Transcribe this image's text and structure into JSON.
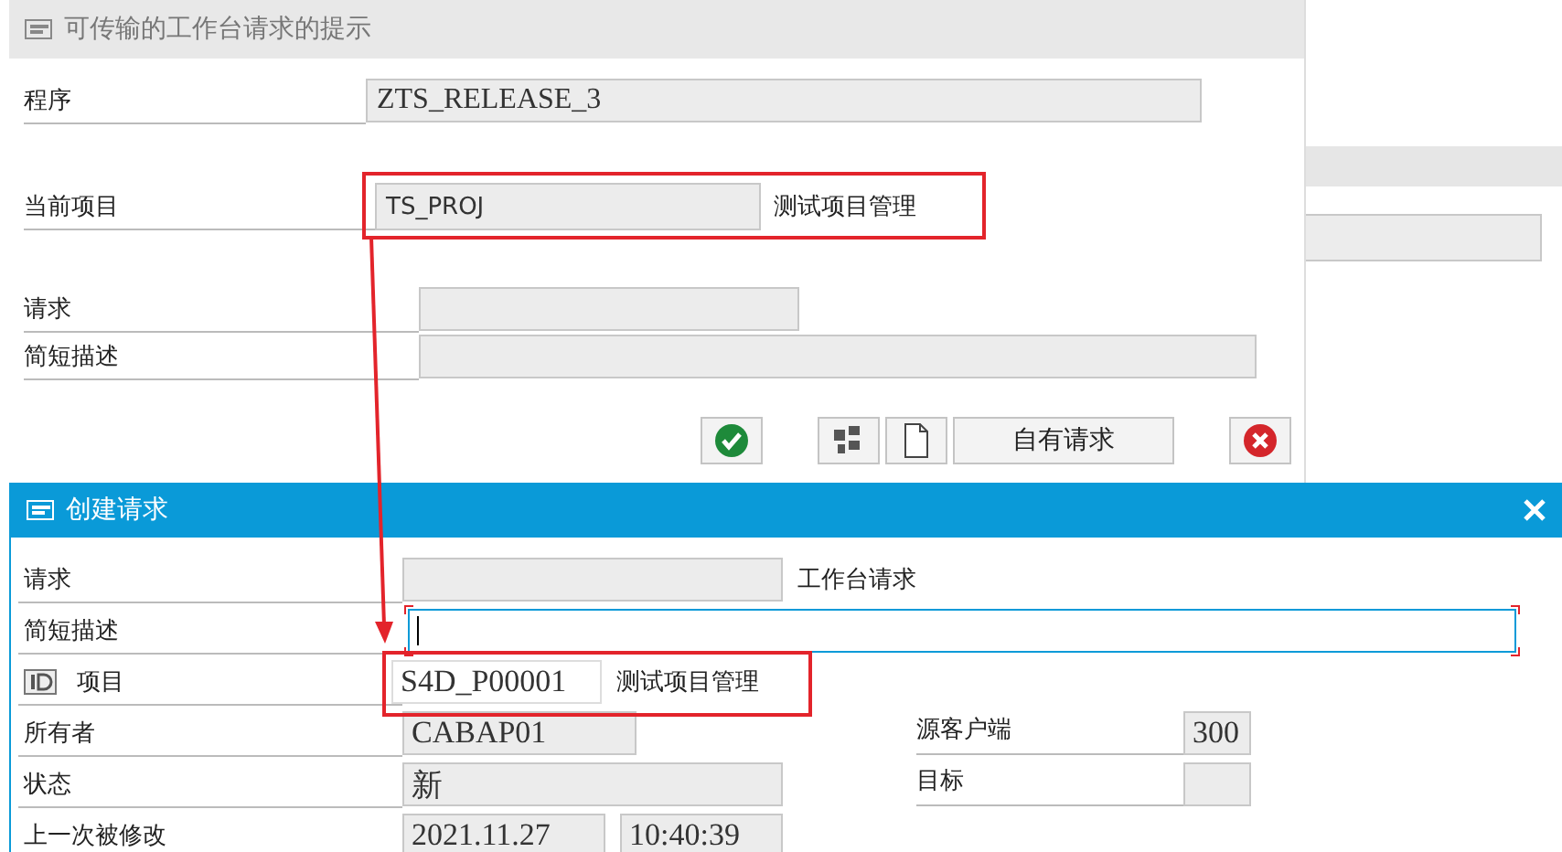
{
  "top_dialog": {
    "title": "可传输的工作台请求的提示",
    "fields": [
      {
        "label": "程序",
        "value": "ZTS_RELEASE_3",
        "kind": "wide"
      },
      {
        "label": "当前项目",
        "value": "TS_PROJ",
        "description": "测试项目管理",
        "kind": "project"
      },
      {
        "label": "请求",
        "kind": "short"
      },
      {
        "label": "简短描述",
        "kind": "long"
      }
    ],
    "buttons": [
      {
        "kind": "confirm"
      },
      {
        "kind": "hierarchy"
      },
      {
        "kind": "document"
      },
      {
        "kind": "text",
        "label": "自有请求"
      },
      {
        "kind": "cancel"
      }
    ]
  },
  "bottom_dialog": {
    "title": "创建请求",
    "rows": [
      {
        "label": "请求",
        "field": {
          "kind": "medium"
        },
        "description": "工作台请求"
      },
      {
        "label": "简短描述",
        "field": {
          "kind": "input"
        }
      },
      {
        "label": "项目",
        "icon": true,
        "field": {
          "kind": "project",
          "value": "S4D_P00001"
        },
        "description": "测试项目管理"
      },
      {
        "label": "所有者",
        "field": {
          "kind": "owner",
          "value": "CABAP01"
        },
        "right": {
          "label": "源客户端",
          "value": "300"
        }
      },
      {
        "label": "状态",
        "field": {
          "kind": "medium",
          "value": "新"
        },
        "right": {
          "label": "目标"
        }
      },
      {
        "label": "上一次被修改",
        "field": {
          "kind": "date",
          "value": "2021.11.27"
        },
        "extra": "10:40:39"
      }
    ]
  }
}
